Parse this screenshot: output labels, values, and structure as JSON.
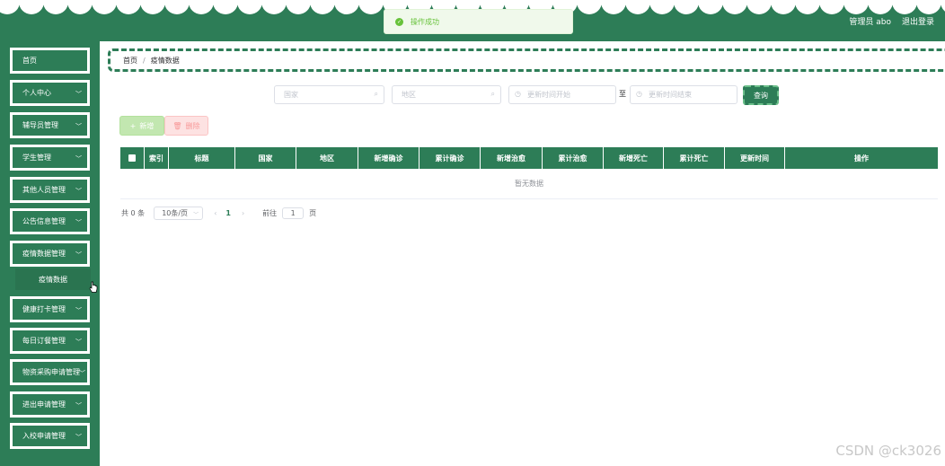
{
  "topbar": {
    "user": "管理员 abo",
    "logout": "退出登录"
  },
  "toast": {
    "message": "操作成功"
  },
  "sidebar": {
    "items": [
      {
        "label": "首页"
      },
      {
        "label": "个人中心"
      },
      {
        "label": "辅导员管理"
      },
      {
        "label": "学生管理"
      },
      {
        "label": "其他人员管理"
      },
      {
        "label": "公告信息管理"
      },
      {
        "label": "疫情数据管理"
      },
      {
        "label": "健康打卡管理"
      },
      {
        "label": "每日订餐管理"
      },
      {
        "label": "物资采购申请管理"
      },
      {
        "label": "进出申请管理"
      },
      {
        "label": "入校申请管理"
      }
    ],
    "submenu": {
      "label": "疫情数据"
    }
  },
  "breadcrumb": {
    "home": "首页",
    "current": "疫情数据"
  },
  "search": {
    "country_placeholder": "国家",
    "region_placeholder": "地区",
    "start_placeholder": "更新时间开始",
    "end_placeholder": "更新时间结束",
    "to_label": "至",
    "query_label": "查询"
  },
  "actions": {
    "add_label": "新增",
    "delete_label": "删除"
  },
  "table": {
    "columns": [
      "索引",
      "标题",
      "国家",
      "地区",
      "新增确诊",
      "累计确诊",
      "新增治愈",
      "累计治愈",
      "新增死亡",
      "累计死亡",
      "更新时间",
      "操作"
    ],
    "empty_text": "暂无数据"
  },
  "pagination": {
    "total": "共 0 条",
    "page_size": "10条/页",
    "current_page": "1",
    "goto_label": "前往",
    "goto_value": "1",
    "page_suffix": "页"
  },
  "watermark": "CSDN @ck3026",
  "colors": {
    "primary": "#2d7d57",
    "success": "#67c23a",
    "danger": "#f89898"
  }
}
